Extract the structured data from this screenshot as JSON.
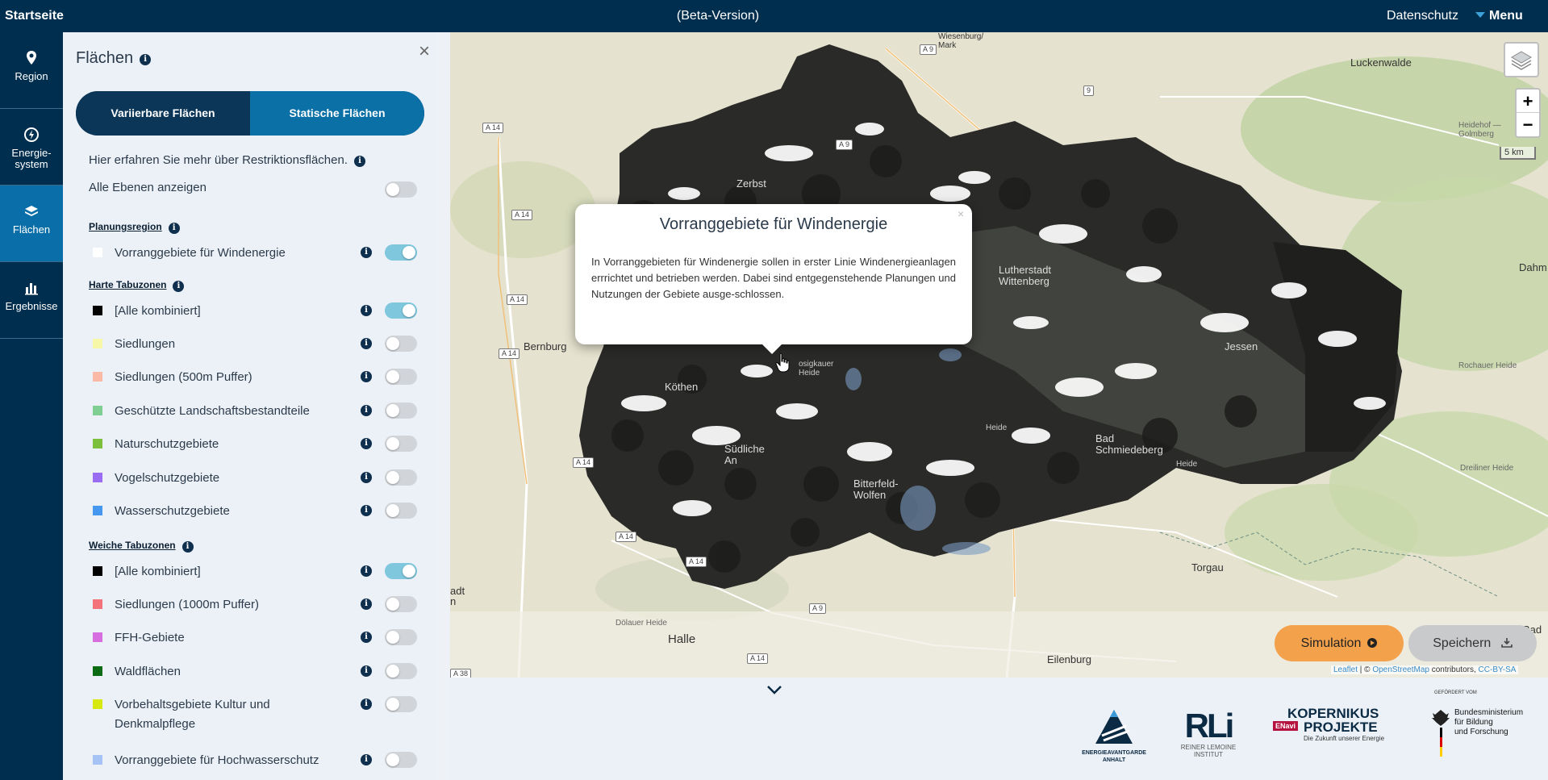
{
  "topbar": {
    "home": "Startseite",
    "beta": "(Beta-Version)",
    "privacy": "Datenschutz",
    "menu": "Menu"
  },
  "nav": [
    {
      "label": "Region",
      "icon": "map-marker-icon"
    },
    {
      "label": "Energie-\nsystem",
      "icon": "energy-icon"
    },
    {
      "label": "Flächen",
      "icon": "layers-icon"
    },
    {
      "label": "Ergebnisse",
      "icon": "bar-chart-icon"
    }
  ],
  "panel": {
    "title": "Flächen",
    "tab_variable": "Variierbare Flächen",
    "tab_static": "Statische Flächen",
    "hint": "Hier erfahren Sie mehr über Restriktionsflächen.",
    "show_all": "Alle Ebenen anzeigen",
    "section_planning": "Planungsregion",
    "section_hard": "Harte Tabuzonen",
    "section_soft": "Weiche Tabuzonen",
    "planning_items": [
      {
        "label": "Vorranggebiete für Windenergie",
        "color": "#ffffff",
        "on": true
      }
    ],
    "hard_items": [
      {
        "label": "[Alle kombiniert]",
        "color": "#000000",
        "on": true
      },
      {
        "label": "Siedlungen",
        "color": "#f7f7a8",
        "on": false
      },
      {
        "label": "Siedlungen (500m Puffer)",
        "color": "#f9b9a4",
        "on": false
      },
      {
        "label": "Geschützte Landschaftsbestandteile",
        "color": "#7fcf93",
        "on": false
      },
      {
        "label": "Naturschutzgebiete",
        "color": "#7cbf3a",
        "on": false
      },
      {
        "label": "Vogelschutzgebiete",
        "color": "#9a6cf2",
        "on": false
      },
      {
        "label": "Wasserschutzgebiete",
        "color": "#4597f0",
        "on": false
      }
    ],
    "soft_items": [
      {
        "label": "[Alle kombiniert]",
        "color": "#000000",
        "on": true
      },
      {
        "label": "Siedlungen (1000m Puffer)",
        "color": "#f2737a",
        "on": false
      },
      {
        "label": "FFH-Gebiete",
        "color": "#d66ee0",
        "on": false
      },
      {
        "label": "Waldflächen",
        "color": "#0a6b12",
        "on": false
      },
      {
        "label": "Vorbehaltsgebiete Kultur und",
        "label2": "Denkmalpflege",
        "color": "#d6e80f",
        "on": false
      },
      {
        "label": "Vorranggebiete für Hochwasserschutz",
        "color": "#a6c3f5",
        "on": false
      }
    ]
  },
  "popup": {
    "title": "Vorranggebiete für Windenergie",
    "body": "In Vorranggebieten für Windenergie sollen in erster Linie Windenergieanlagen errrichtet und betrieben werden. Dabei sind entgegenstehende Planungen und Nutzungen der Gebiete ausge-schlossen."
  },
  "map": {
    "labels": {
      "wiesenburg": "Wiesenburg/\nMark",
      "luckenwalde": "Luckenwalde",
      "zerbst": "Zerbst",
      "lutherstadt": "Lutherstadt\nWittenberg",
      "bernburg": "Bernburg",
      "koethen": "Köthen",
      "jessen": "Jessen",
      "dahme": "Dahm",
      "bad_schmiedeberg": "Bad\nSchmiedeberg",
      "bitterfeld": "Bitterfeld-\nWolfen",
      "torgau": "Torgau",
      "halle": "Halle",
      "eilenburg": "Eilenburg",
      "bad": "Bad",
      "heidehof": "Heidehof —\nGolmberg",
      "rochauer": "Rochauer Heide",
      "dreiliner": "Dreiliner Heide",
      "doelauer": "Dölauer Heide",
      "sudt": "adt\nn",
      "heide1": "Heide",
      "heide2": "Heide",
      "osigkauer": "osigkauer\nHeide",
      "sudl": "Südliche\nAn"
    },
    "roads": [
      "A 9",
      "A 14",
      "A 14",
      "A 9",
      "A 14",
      "A 14",
      "A 14",
      "A 14",
      "A 14",
      "A 9",
      "A 14",
      "A 38",
      "9"
    ],
    "scale": "5 km",
    "zoom_in": "+",
    "zoom_out": "−"
  },
  "actions": {
    "simulate": "Simulation",
    "save": "Speichern"
  },
  "attribution": {
    "leaflet": "Leaflet",
    "sep": " | © ",
    "osm": "OpenStreetMap",
    "contrib": " contributors, ",
    "license": "CC-BY-SA"
  },
  "footer": {
    "logo1_line1": "ENERGIEAVANTGARDE",
    "logo1_line2": "ANHALT",
    "logo2_mark": "RLi",
    "logo2_line1": "REINER LEMOINE",
    "logo2_line2": "INSTITUT",
    "logo3_line1": "KOPERNIKUS",
    "logo3_line2": "PROJEKTE",
    "logo3_tag": "ENavi",
    "logo3_sub": "Die Zukunft unserer Energie",
    "logo4_top": "GEFÖRDERT VOM",
    "logo4_line1": "Bundesministerium",
    "logo4_line2": "für Bildung",
    "logo4_line3": "und Forschung"
  }
}
